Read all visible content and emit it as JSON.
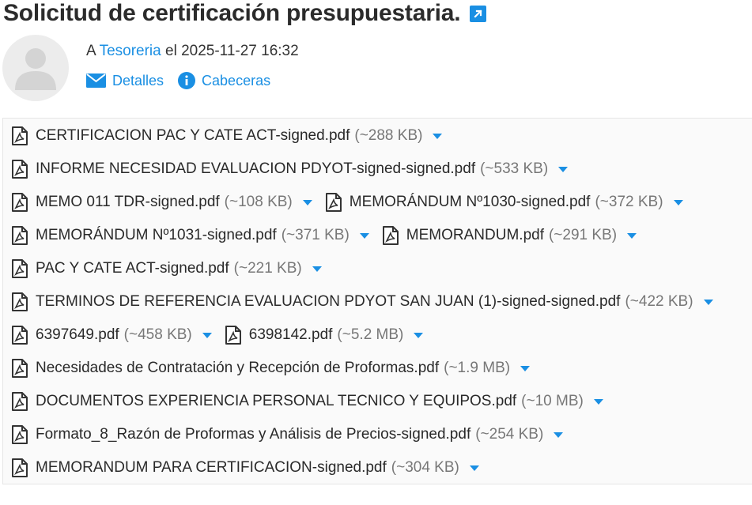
{
  "message": {
    "subject": "Solicitud de certificación presupuestaria.",
    "to_prefix": "A",
    "recipient": "Tesoreria",
    "date_prefix": "el",
    "date": "2025-11-27 16:32"
  },
  "actions": {
    "details_label": "Detalles",
    "headers_label": "Cabeceras"
  },
  "colors": {
    "accent": "#1a8fe3",
    "title": "#2b2b2b",
    "size_text": "#777777"
  },
  "attachments": [
    {
      "name": "CERTIFICACION PAC Y CATE ACT-signed.pdf",
      "size": "(~288 KB)"
    },
    {
      "name": "INFORME NECESIDAD EVALUACION PDYOT-signed-signed.pdf",
      "size": "(~533 KB)"
    },
    {
      "name": "MEMO 011 TDR-signed.pdf",
      "size": "(~108 KB)"
    },
    {
      "name": "MEMORÁNDUM Nº1030-signed.pdf",
      "size": "(~372 KB)"
    },
    {
      "name": "MEMORÁNDUM Nº1031-signed.pdf",
      "size": "(~371 KB)"
    },
    {
      "name": "MEMORANDUM.pdf",
      "size": "(~291 KB)"
    },
    {
      "name": "PAC Y CATE ACT-signed.pdf",
      "size": "(~221 KB)"
    },
    {
      "name": "TERMINOS DE REFERENCIA EVALUACION PDYOT SAN JUAN (1)-signed-signed.pdf",
      "size": "(~422 KB)"
    },
    {
      "name": "6397649.pdf",
      "size": "(~458 KB)"
    },
    {
      "name": "6398142.pdf",
      "size": "(~5.2 MB)"
    },
    {
      "name": "Necesidades de Contratación y Recepción de Proformas.pdf",
      "size": "(~1.9 MB)"
    },
    {
      "name": "DOCUMENTOS EXPERIENCIA PERSONAL TECNICO Y EQUIPOS.pdf",
      "size": "(~10 MB)"
    },
    {
      "name": "Formato_8_Razón de Proformas y Análisis de Precios-signed.pdf",
      "size": "(~254 KB)"
    },
    {
      "name": "MEMORANDUM PARA CERTIFICACION-signed.pdf",
      "size": "(~304 KB)"
    }
  ]
}
